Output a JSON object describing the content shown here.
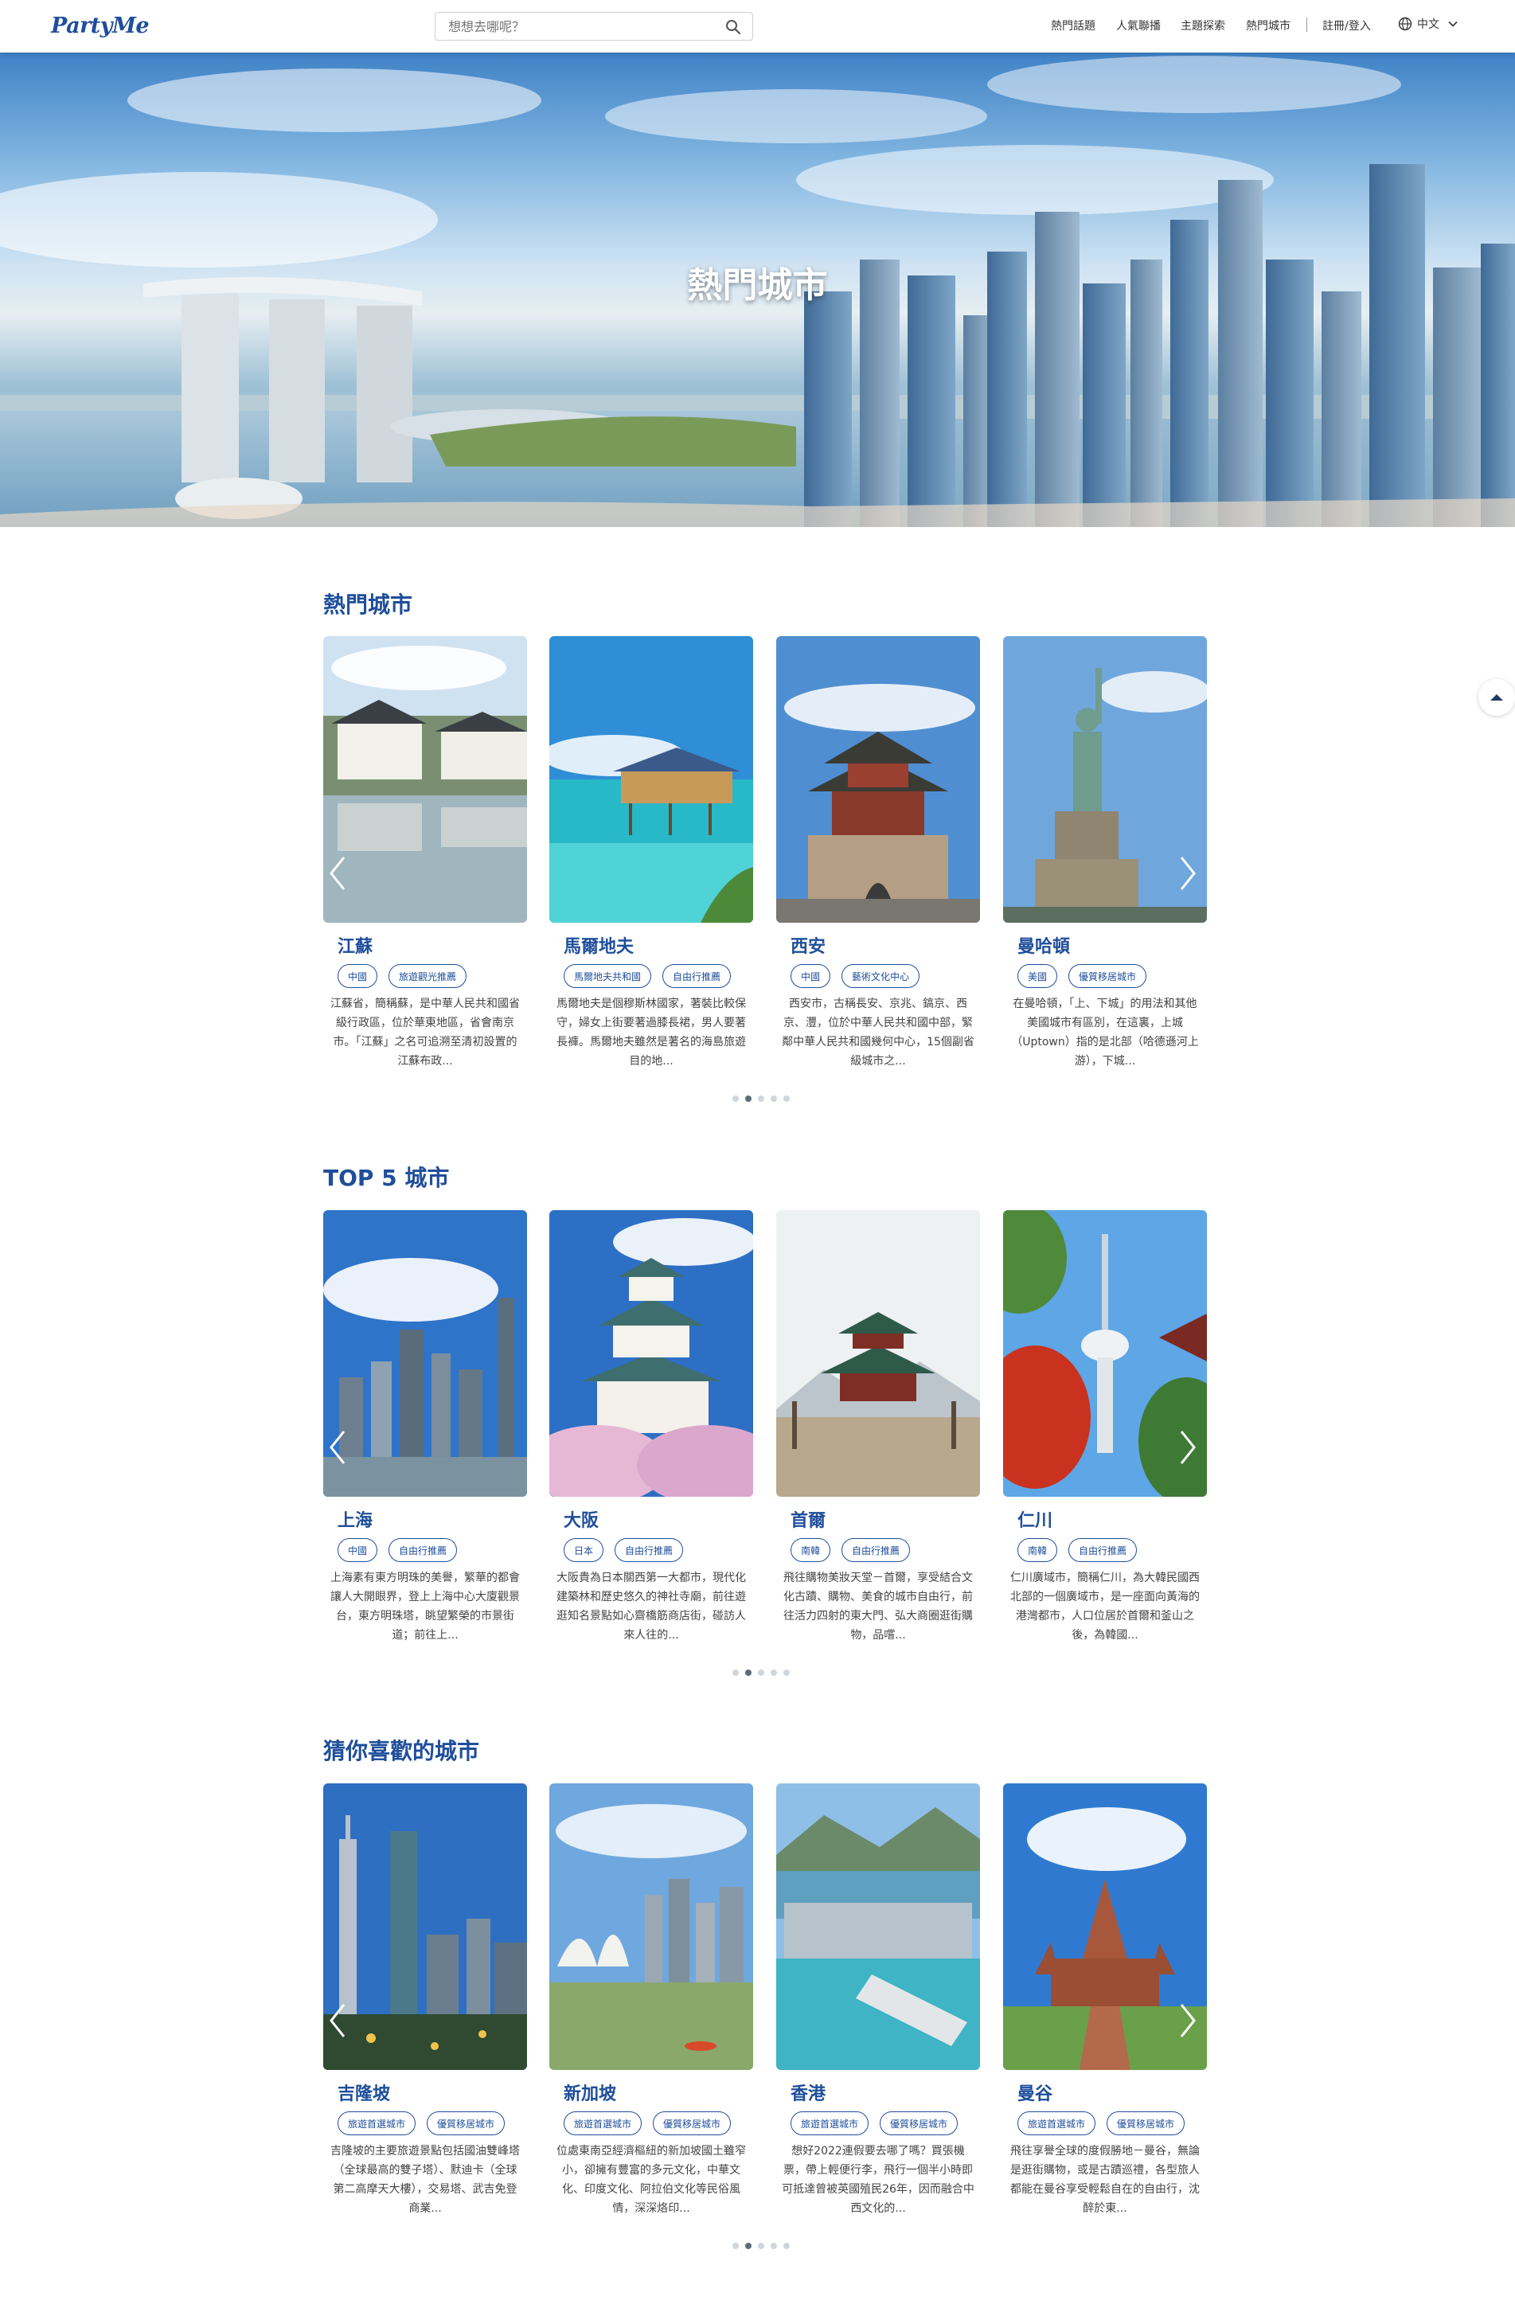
{
  "header": {
    "logo": "PartyMe",
    "search_placeholder": "想想去哪呢？",
    "nav": [
      "熱門話題",
      "人氣聯播",
      "主題探索",
      "熱門城市"
    ],
    "auth": "註冊/登入",
    "language": "中文"
  },
  "hero": {
    "title": "熱門城市"
  },
  "sections": [
    {
      "title": "熱門城市",
      "cards": [
        {
          "name": "江蘇",
          "tags": [
            "中國",
            "旅遊觀光推薦"
          ],
          "desc": "江蘇省，簡稱蘇，是中華人民共和國省級行政區，位於華東地區，省會南京市。「江蘇」之名可追溯至清初設置的江蘇布政..."
        },
        {
          "name": "馬爾地夫",
          "tags": [
            "馬爾地夫共和國",
            "自由行推薦"
          ],
          "desc": "馬爾地夫是個穆斯林國家，著裝比較保守，婦女上街要著過膝長裙，男人要著長褲。馬爾地夫雖然是著名的海島旅遊目的地..."
        },
        {
          "name": "西安",
          "tags": [
            "中國",
            "藝術文化中心"
          ],
          "desc": "西安市，古稱長安、京兆、鎬京、西京、灃，位於中華人民共和國中部，緊鄰中華人民共和國幾何中心，15個副省級城市之..."
        },
        {
          "name": "曼哈頓",
          "tags": [
            "美國",
            "優質移居城市"
          ],
          "desc": "在曼哈頓，「上、下城」的用法和其他美國城市有區別，在這裏，上城（Uptown）指的是北部（哈德遜河上游），下城..."
        }
      ]
    },
    {
      "title": "TOP 5 城市",
      "cards": [
        {
          "name": "上海",
          "tags": [
            "中國",
            "自由行推薦"
          ],
          "desc": "上海素有東方明珠的美譽，繁華的都會讓人大開眼界，登上上海中心大廈觀景台，東方明珠塔，眺望繁榮的市景街道；前往上..."
        },
        {
          "name": "大阪",
          "tags": [
            "日本",
            "自由行推薦"
          ],
          "desc": "大阪貴為日本關西第一大都市，現代化建築林和歷史悠久的神社寺廟，前往遊逛知名景點如心齋橋筋商店街，碰訪人來人往的..."
        },
        {
          "name": "首爾",
          "tags": [
            "南韓",
            "自由行推薦"
          ],
          "desc": "飛往購物美妝天堂－首爾，享受結合文化古蹟、購物、美食的城市自由行，前往活力四射的東大門、弘大商圈逛街購物，品嚐..."
        },
        {
          "name": "仁川",
          "tags": [
            "南韓",
            "自由行推薦"
          ],
          "desc": "仁川廣域市，簡稱仁川，為大韓民國西北部的一個廣域市，是一座面向黃海的港灣都市，人口位居於首爾和釜山之後，為韓國..."
        }
      ]
    },
    {
      "title": "猜你喜歡的城市",
      "cards": [
        {
          "name": "吉隆坡",
          "tags": [
            "旅遊首選城市",
            "優質移居城市"
          ],
          "desc": "吉隆坡的主要旅遊景點包括國油雙峰塔（全球最高的雙子塔）、默迪卡（全球第二高摩天大樓），交易塔、武吉免登商業..."
        },
        {
          "name": "新加坡",
          "tags": [
            "旅遊首選城市",
            "優質移居城市"
          ],
          "desc": "位處東南亞經濟樞紐的新加坡國土雖窄小，卻擁有豐富的多元文化，中華文化、印度文化、阿拉伯文化等民俗風情，深深烙印..."
        },
        {
          "name": "香港",
          "tags": [
            "旅遊首選城市",
            "優質移居城市"
          ],
          "desc": "想好2022連假要去哪了嗎？買張機票，帶上輕便行李，飛行一個半小時即可抵達曾被英國殖民26年，因而融合中西文化的..."
        },
        {
          "name": "曼谷",
          "tags": [
            "旅遊首選城市",
            "優質移居城市"
          ],
          "desc": "飛往享譽全球的度假勝地－曼谷，無論是逛街購物，或是古蹟巡禮，各型旅人都能在曼谷享受輕鬆自在的自由行，沈醉於東..."
        }
      ]
    }
  ],
  "colors": {
    "brand": "#1f4e9b",
    "dot_active": "#5f6b78",
    "dot": "#cfd6de"
  },
  "icons": [
    "search-icon",
    "globe-icon",
    "chevron-down-icon",
    "chevron-left-icon",
    "chevron-right-icon",
    "caret-up-icon"
  ]
}
